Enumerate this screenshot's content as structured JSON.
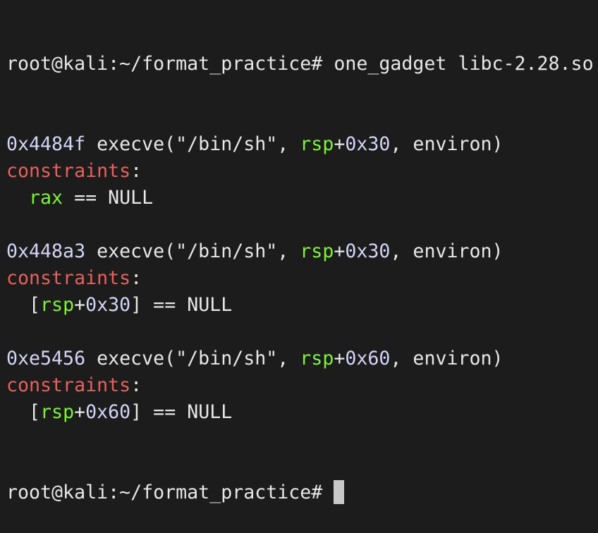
{
  "prompt": "root@kali:~/format_practice# ",
  "command": "one_gadget libc-2.28.so",
  "constraints_label": "constraints",
  "colon": ":",
  "gadgets": [
    {
      "address": "0x4484f",
      "call_prefix": " execve(\"/bin/sh\", ",
      "reg": "rsp",
      "plus": "+",
      "offset": "0x30",
      "call_suffix": ", environ)",
      "constraint": {
        "open": "",
        "reg": "rax",
        "plus": "",
        "offset": "",
        "rest": " == NULL"
      }
    },
    {
      "address": "0x448a3",
      "call_prefix": " execve(\"/bin/sh\", ",
      "reg": "rsp",
      "plus": "+",
      "offset": "0x30",
      "call_suffix": ", environ)",
      "constraint": {
        "open": "[",
        "reg": "rsp",
        "plus": "+",
        "offset": "0x30",
        "rest": "] == NULL"
      }
    },
    {
      "address": "0xe5456",
      "call_prefix": " execve(\"/bin/sh\", ",
      "reg": "rsp",
      "plus": "+",
      "offset": "0x60",
      "call_suffix": ", environ)",
      "constraint": {
        "open": "[",
        "reg": "rsp",
        "plus": "+",
        "offset": "0x60",
        "rest": "] == NULL"
      }
    }
  ],
  "colors": {
    "background": "#1c1c1c",
    "text": "#e8e8e8",
    "address": "#d6d4f7",
    "label": "#e8605e",
    "register": "#7ff23c"
  }
}
